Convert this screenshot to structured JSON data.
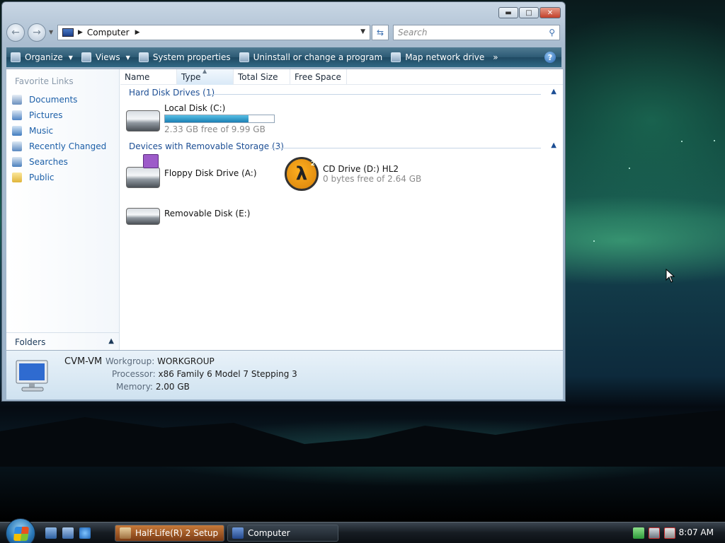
{
  "window": {
    "title": "Computer"
  },
  "address": {
    "crumb": "Computer",
    "search_placeholder": "Search"
  },
  "toolbar": {
    "organize": "Organize",
    "views": "Views",
    "system_properties": "System properties",
    "uninstall": "Uninstall or change a program",
    "map_drive": "Map network drive",
    "more": "»",
    "help": "?"
  },
  "sidebar": {
    "title": "Favorite Links",
    "items": [
      {
        "label": "Documents",
        "icon": "documents-icon"
      },
      {
        "label": "Pictures",
        "icon": "pictures-icon"
      },
      {
        "label": "Music",
        "icon": "music-icon"
      },
      {
        "label": "Recently Changed",
        "icon": "recently-changed-icon"
      },
      {
        "label": "Searches",
        "icon": "searches-icon"
      },
      {
        "label": "Public",
        "icon": "public-folder-icon"
      }
    ],
    "folders": "Folders"
  },
  "columns": [
    "Name",
    "Type",
    "Total Size",
    "Free Space"
  ],
  "groups": {
    "hdd": "Hard Disk Drives (1)",
    "removable": "Devices with Removable Storage (3)"
  },
  "drives": {
    "local": {
      "name": "Local Disk (C:)",
      "free": "2.33 GB free of 9.99 GB",
      "used_fraction": 0.767
    },
    "floppy": {
      "name": "Floppy Disk Drive (A:)"
    },
    "cd": {
      "name": "CD Drive (D:) HL2",
      "free": "0 bytes free of 2.64 GB"
    },
    "removable": {
      "name": "Removable Disk (E:)"
    }
  },
  "details": {
    "computer_name": "CVM-VM",
    "workgroup_label": "Workgroup:",
    "workgroup": "WORKGROUP",
    "processor_label": "Processor:",
    "processor": "x86 Family 6 Model 7 Stepping 3",
    "memory_label": "Memory:",
    "memory": "2.00 GB"
  },
  "taskbar": {
    "buttons": [
      {
        "label": "Half-Life(R) 2 Setup"
      },
      {
        "label": "Computer"
      }
    ],
    "clock": "8:07 AM"
  },
  "colors": {
    "link": "#1c5fa8",
    "progress": "#1b7fb4",
    "close": "#c2402a"
  }
}
